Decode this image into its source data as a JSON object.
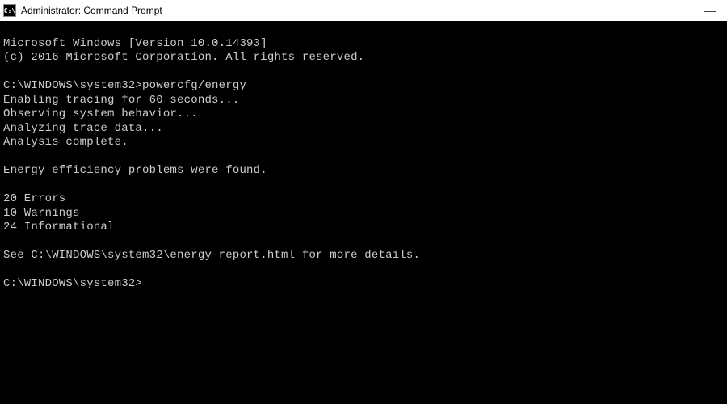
{
  "titlebar": {
    "icon_text": "C:\\",
    "title": "Administrator: Command Prompt"
  },
  "window_controls": {
    "minimize": "—"
  },
  "terminal": {
    "header_line1": "Microsoft Windows [Version 10.0.14393]",
    "header_line2": "(c) 2016 Microsoft Corporation. All rights reserved.",
    "prompt1_path": "C:\\WINDOWS\\system32>",
    "prompt1_command": "powercfg/energy",
    "line_enabling": "Enabling tracing for 60 seconds...",
    "line_observing": "Observing system behavior...",
    "line_analyzing": "Analyzing trace data...",
    "line_complete": "Analysis complete.",
    "line_problems": "Energy efficiency problems were found.",
    "line_errors": "20 Errors",
    "line_warnings": "10 Warnings",
    "line_informational": "24 Informational",
    "line_report": "See C:\\WINDOWS\\system32\\energy-report.html for more details.",
    "prompt2_path": "C:\\WINDOWS\\system32>"
  }
}
